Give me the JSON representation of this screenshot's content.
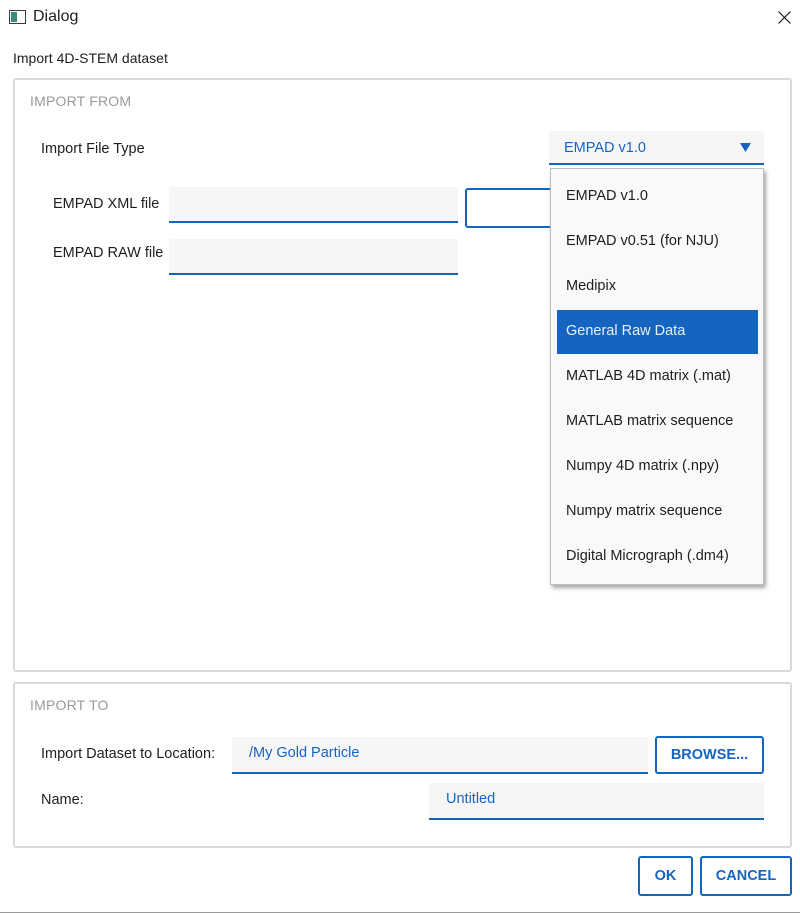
{
  "window": {
    "title": "Dialog",
    "heading": "Import 4D-STEM dataset"
  },
  "import_from": {
    "title": "IMPORT FROM",
    "file_type_label": "Import File Type",
    "file_type_value": "EMPAD v1.0",
    "xml_label": "EMPAD XML file",
    "xml_value": "",
    "raw_label": "EMPAD RAW file",
    "raw_value": "",
    "dropdown_options": [
      "EMPAD v1.0",
      "EMPAD v0.51 (for NJU)",
      "Medipix",
      "General Raw Data",
      "MATLAB 4D matrix (.mat)",
      "MATLAB matrix sequence",
      "Numpy 4D matrix (.npy)",
      "Numpy matrix sequence",
      "Digital Micrograph (.dm4)"
    ],
    "highlighted_option": "General Raw Data"
  },
  "import_to": {
    "title": "IMPORT TO",
    "location_label": "Import Dataset to Location:",
    "location_value": "/My Gold Particle",
    "browse_label": "BROWSE...",
    "name_label": "Name:",
    "name_value": "Untitled"
  },
  "footer": {
    "ok_label": "OK",
    "cancel_label": "CANCEL"
  },
  "colors": {
    "accent": "#1565c0",
    "field_bg": "#f6f6f6",
    "group_border": "#d9d9d9",
    "group_title": "#9a9a9a"
  },
  "icons": {
    "app": "window-app-icon",
    "close": "close-icon",
    "dropdown": "triangle-down-icon"
  }
}
